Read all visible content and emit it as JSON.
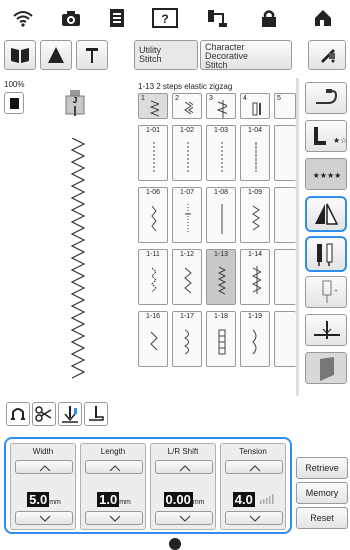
{
  "top_icons": [
    "wifi-icon",
    "camera-icon",
    "document-icon",
    "help-icon",
    "thread-icon",
    "lock-icon",
    "home-icon"
  ],
  "tabs": {
    "book_icon": "book-icon",
    "triangle_icon": "needle-position-icon",
    "needle_icon": "needle-icon",
    "utility_label_line1": "Utility",
    "utility_label_line2": "Stitch",
    "character_label_line1": "Character",
    "character_label_line2": "Decorative",
    "character_label_line3": "Stitch",
    "settings_icon": "settings-icon"
  },
  "preview": {
    "zoom": "100%"
  },
  "grid": {
    "caption": "1-13  2 steps elastic zigzag",
    "top_row_labels": [
      "1",
      "2",
      "3",
      "4",
      "5"
    ],
    "cells": [
      [
        "1-01",
        "1-02",
        "1-03",
        "1-04"
      ],
      [
        "1-06",
        "1-07",
        "1-08",
        "1-09"
      ],
      [
        "1-11",
        "1-12",
        "1-13",
        "1-14"
      ],
      [
        "1-16",
        "1-17",
        "1-18",
        "1-19"
      ]
    ],
    "selected": "1-13"
  },
  "bottom_tools": [
    "thread-cut-icon",
    "scissors-icon",
    "needle-stop-icon",
    "presser-foot-icon"
  ],
  "panel": {
    "width_label": "Width",
    "width_value": "5.0",
    "width_unit": "mm",
    "length_label": "Length",
    "length_value": "1.0",
    "length_unit": "mm",
    "shift_label": "L/R Shift",
    "shift_value": "0.00",
    "shift_unit": "mm",
    "tension_label": "Tension",
    "tension_value": "4.0"
  },
  "side_buttons": {
    "retrieve": "Retrieve",
    "memory": "Memory",
    "reset": "Reset"
  },
  "colors": {
    "accent": "#2e8ff0",
    "selected_cell": "#c9c9c9"
  }
}
